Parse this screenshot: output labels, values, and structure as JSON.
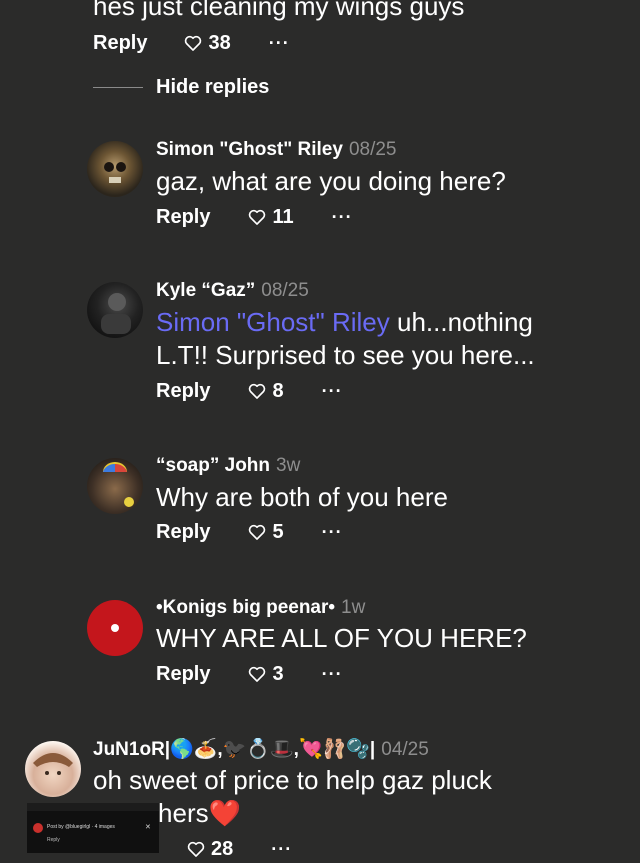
{
  "top_comment": {
    "text": "hes just cleaning my wings guys",
    "reply_label": "Reply",
    "likes": "38",
    "more": "···"
  },
  "hide_replies_label": "Hide replies",
  "replies": [
    {
      "author": "Simon \"Ghost\" Riley",
      "date": "08/25",
      "text": "gaz, what are you doing here?",
      "reply_label": "Reply",
      "likes": "11",
      "more": "···"
    },
    {
      "author": "Kyle “Gaz”",
      "date": "08/25",
      "mention": "Simon \"Ghost\" Riley",
      "text_line1": " uh...nothing",
      "text_line2": "L.T!! Surprised to see you here...",
      "reply_label": "Reply",
      "likes": "8",
      "more": "···"
    },
    {
      "author": "“soap” John",
      "date": "3w",
      "text": "Why are both of you here",
      "reply_label": "Reply",
      "likes": "5",
      "more": "···"
    },
    {
      "author": "•Konigs big peenar•",
      "date": "1w",
      "text": "WHY ARE ALL OF YOU HERE?",
      "reply_label": "Reply",
      "likes": "3",
      "more": "···"
    }
  ],
  "bottom_comment": {
    "author": "JuN1oR|🌎🍝,🐦‍⬛💍🎩,💘🩰🫧|",
    "date": "04/25",
    "text_line1": "oh sweet of price to help gaz pluck",
    "text_line2": "e feathers❤️",
    "likes": "28",
    "more": "···"
  },
  "thumbnail": {
    "post_text": "Post by @bluegirlgl · 4 images",
    "reply_text": "Reply"
  },
  "colors": {
    "background": "#2b2b2a",
    "mention": "#6a6bf5",
    "date": "#8e8e8e"
  }
}
